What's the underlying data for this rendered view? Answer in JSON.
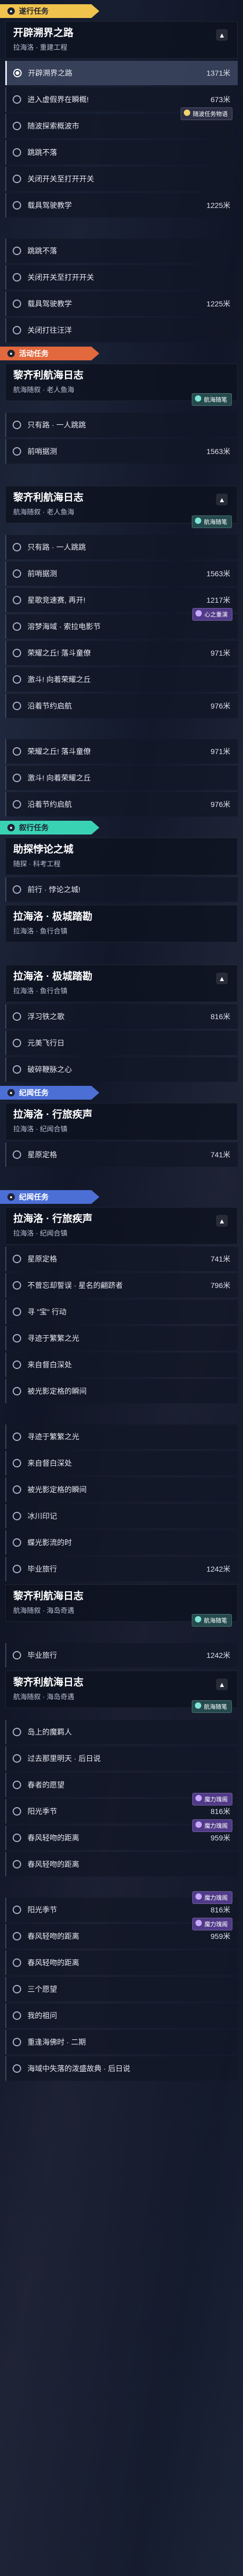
{
  "tags": {
    "tracking": "遂行任务",
    "activity": "活动任务",
    "story": "叙行任务",
    "travel": "纪闻任务"
  },
  "badges": {
    "b1": "随波任务物语",
    "b2": "航海随笔",
    "b3": "心之重演",
    "b4": "航海随笔",
    "b5": "航海随笔",
    "b6": "魔力瑰阁",
    "b7": "魔力瑰阁",
    "b8": "魔力瑰阁",
    "b9": "魔力瑰阁"
  },
  "q1": {
    "title": "开辟溯界之路",
    "sub": "拉海洛 · 重建工程",
    "objs": [
      {
        "label": "开辟溯界之路",
        "dist": "1371米"
      },
      {
        "label": "进入虚假界在瞬概!",
        "dist": "673米"
      },
      {
        "label": "随波探索概波市",
        "dist": ""
      },
      {
        "label": "跳跳不落",
        "dist": ""
      },
      {
        "label": "关闭开关至打开开关",
        "dist": ""
      },
      {
        "label": "载具驾驶教学",
        "dist": "1225米"
      },
      {
        "label": "跳跳不落",
        "dist": ""
      },
      {
        "label": "关闭开关至打开开关",
        "dist": ""
      },
      {
        "label": "载具驾驶教学",
        "dist": "1225米"
      },
      {
        "label": "关闭打往汪洋",
        "dist": ""
      }
    ]
  },
  "q2": {
    "title": "黎齐利航海日志",
    "sub": "航海随叙 · 老人鱼海",
    "objs": [
      {
        "label": "只有路 · 一人跳跳",
        "dist": ""
      },
      {
        "label": "前哨据测",
        "dist": "1563米"
      }
    ]
  },
  "q3": {
    "title": "黎齐利航海日志",
    "sub": "航海随叙 · 老人鱼海",
    "objs": [
      {
        "label": "只有路 · 一人跳跳",
        "dist": ""
      },
      {
        "label": "前哨据测",
        "dist": "1563米"
      },
      {
        "label": "星歌竞速赛, 再开!",
        "dist": "1217米"
      },
      {
        "label": "溶梦海域 · 索拉电影节",
        "dist": ""
      },
      {
        "label": "荣耀之丘! 落斗童僚",
        "dist": "971米"
      },
      {
        "label": "激斗! 向着荣耀之丘",
        "dist": ""
      },
      {
        "label": "沿着节约启航",
        "dist": "976米"
      },
      {
        "label": "荣耀之丘! 落斗童僚",
        "dist": "971米"
      },
      {
        "label": "激斗! 向着荣耀之丘",
        "dist": ""
      },
      {
        "label": "沿着节约启航",
        "dist": "976米"
      }
    ]
  },
  "q4": {
    "title": "助探悖论之城",
    "sub": "随探 · 科考工程",
    "objs": [
      {
        "label": "前行 · 悖论之城!",
        "dist": ""
      }
    ]
  },
  "q5": {
    "title": "拉海洛 · 极城踏勘",
    "sub": "拉海洛 · 鱼行合镇",
    "objs": []
  },
  "q6": {
    "title": "拉海洛 · 极城踏勘",
    "sub": "拉海洛 · 鱼行合镇",
    "objs": [
      {
        "label": "浮习铁之歌",
        "dist": "816米"
      },
      {
        "label": "元美飞行日",
        "dist": ""
      },
      {
        "label": "破碎鞭脉之心",
        "dist": ""
      }
    ]
  },
  "q7": {
    "title": "拉海洛 · 行旅疾声",
    "sub": "拉海洛 · 纪闻合镇",
    "objs": [
      {
        "label": "星原定格",
        "dist": "741米"
      }
    ]
  },
  "q8": {
    "title": "拉海洛 · 行旅疾声",
    "sub": "拉海洛 · 纪闻合镇",
    "objs": [
      {
        "label": "星原定格",
        "dist": "741米"
      },
      {
        "label": "不曾忘却誓误 · 星名的翩跻者",
        "dist": "796米"
      },
      {
        "label": "寻 \"宝\" 行动",
        "dist": ""
      },
      {
        "label": "寻迹于繁繁之光",
        "dist": ""
      },
      {
        "label": "来自督白深处",
        "dist": ""
      },
      {
        "label": "被光影定格的瞬间",
        "dist": ""
      },
      {
        "label": "寻迹于繁繁之光",
        "dist": ""
      },
      {
        "label": "来自督白深处",
        "dist": ""
      },
      {
        "label": "被光影定格的瞬间",
        "dist": ""
      },
      {
        "label": "冰川印记",
        "dist": ""
      },
      {
        "label": "蝶光影流的时",
        "dist": ""
      },
      {
        "label": "毕业旅行",
        "dist": "1242米"
      },
      {
        "label": "毕业旅行",
        "dist": "1242米"
      }
    ]
  },
  "q9": {
    "title": "黎齐利航海日志",
    "sub": "航海随叙 · 海岛奇遇",
    "objs": []
  },
  "q10": {
    "title": "黎齐利航海日志",
    "sub": "航海随叙 · 海岛奇遇",
    "objs": [
      {
        "label": "岛上的魔羁人",
        "dist": ""
      },
      {
        "label": "过去那里明天 · 后日说",
        "dist": ""
      },
      {
        "label": "春者的愿望",
        "dist": ""
      },
      {
        "label": "阳光季节",
        "dist": "816米"
      },
      {
        "label": "春风轻吻的距离",
        "dist": "959米"
      },
      {
        "label": "春风轻吻的距离",
        "dist": ""
      },
      {
        "label": "阳光季节",
        "dist": "816米"
      },
      {
        "label": "春风轻吻的距离",
        "dist": "959米"
      },
      {
        "label": "春风轻吻的距离",
        "dist": ""
      },
      {
        "label": "三个愿望",
        "dist": ""
      },
      {
        "label": "我的祖问",
        "dist": ""
      },
      {
        "label": "重逢海佛时 · 二期",
        "dist": ""
      },
      {
        "label": "海域中失落的泼盛故典 · 后日说",
        "dist": ""
      }
    ]
  },
  "icons": {
    "tag": "ring-icon",
    "active": "target-icon",
    "objective": "circle-icon",
    "collapse": "chevron-up-icon"
  }
}
